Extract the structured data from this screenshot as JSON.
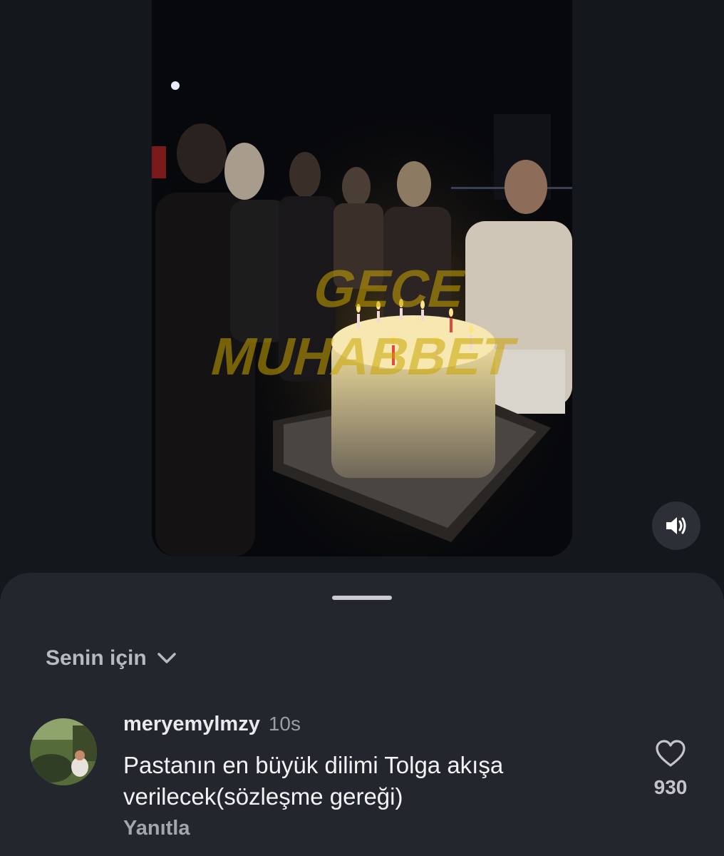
{
  "video": {
    "watermark_line1": "GECE",
    "watermark_line2": "MUHABBET"
  },
  "controls": {
    "sound_icon": "speaker-icon"
  },
  "comments_sheet": {
    "filter_label": "Senin için",
    "filter_icon": "chevron-down-icon",
    "comments": [
      {
        "username": "meryemylmzy",
        "time": "10s",
        "text": "Pastanın en büyük dilimi Tolga akışa verilecek(sözleşme gereği)",
        "reply_label": "Yanıtla",
        "like_count": "930",
        "like_icon": "heart-outline-icon"
      }
    ]
  },
  "colors": {
    "background": "#14171c",
    "sheet": "#24262d",
    "watermark": "#c9a400"
  }
}
